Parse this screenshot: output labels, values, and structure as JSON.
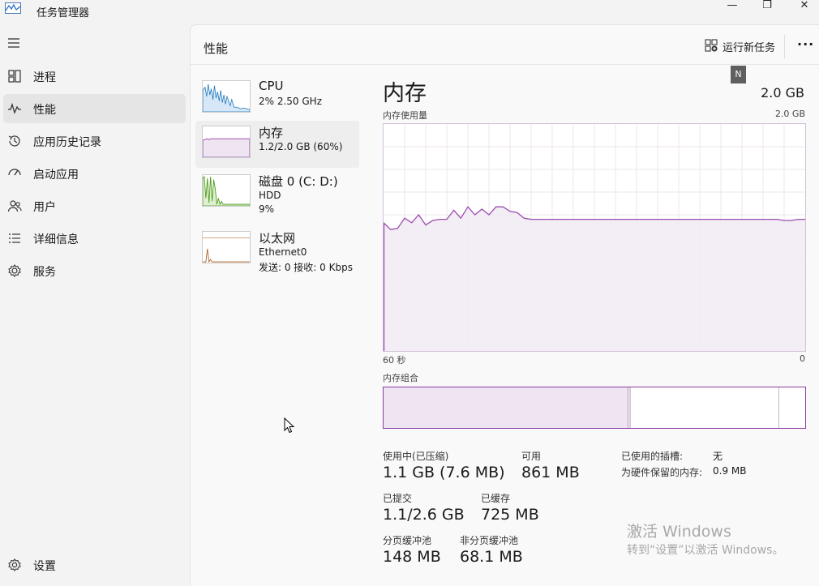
{
  "window": {
    "title": "任务管理器",
    "minimize": "—",
    "maximize": "❐",
    "close": "✕"
  },
  "sidebar": {
    "items": [
      {
        "label": "进程",
        "icon": "processes-icon"
      },
      {
        "label": "性能",
        "icon": "performance-icon",
        "active": true
      },
      {
        "label": "应用历史记录",
        "icon": "app-history-icon"
      },
      {
        "label": "启动应用",
        "icon": "startup-icon"
      },
      {
        "label": "用户",
        "icon": "users-icon"
      },
      {
        "label": "详细信息",
        "icon": "details-icon"
      },
      {
        "label": "服务",
        "icon": "services-icon"
      }
    ],
    "settings": "设置"
  },
  "header": {
    "title": "性能",
    "run_task": "运行新任务",
    "more": "···"
  },
  "resources": [
    {
      "name": "CPU",
      "line1": "2%  2.50 GHz",
      "line2": ""
    },
    {
      "name": "内存",
      "line1": "1.2/2.0 GB (60%)",
      "line2": ""
    },
    {
      "name": "磁盘 0 (C: D:)",
      "line1": "HDD",
      "line2": "9%"
    },
    {
      "name": "以太网",
      "line1": "Ethernet0",
      "line2": "发送: 0  接收: 0 Kbps"
    }
  ],
  "memory": {
    "title": "内存",
    "total": "2.0 GB",
    "badge": "N",
    "usage_label": "内存使用量",
    "usage_max": "2.0 GB",
    "x_left": "60 秒",
    "x_right": "0",
    "composition_label": "内存组合",
    "composition": {
      "in_use": 0.58,
      "modified": 0.005,
      "standby": 0.35
    },
    "stats": {
      "in_use_label": "使用中(已压缩)",
      "in_use_value": "1.1 GB (7.6 MB)",
      "available_label": "可用",
      "available_value": "861 MB",
      "committed_label": "已提交",
      "committed_value": "1.1/2.6 GB",
      "cached_label": "已缓存",
      "cached_value": "725 MB",
      "paged_label": "分页缓冲池",
      "paged_value": "148 MB",
      "nonpaged_label": "非分页缓冲池",
      "nonpaged_value": "68.1 MB",
      "slots_label": "已使用的插槽:",
      "slots_value": "无",
      "reserved_label": "为硬件保留的内存:",
      "reserved_value": "0.9 MB"
    }
  },
  "watermark": {
    "line1": "激活 Windows",
    "line2": "转到“设置”以激活 Windows。"
  },
  "chart_data": {
    "type": "area",
    "title": "",
    "xlabel": "",
    "ylabel": "",
    "xlim": [
      60,
      0
    ],
    "ylim": [
      0,
      2.0
    ],
    "series": [
      {
        "values": [
          1.13,
          1.07,
          1.08,
          1.17,
          1.13,
          1.2,
          1.11,
          1.15,
          1.16,
          1.16,
          1.24,
          1.17,
          1.27,
          1.2,
          1.25,
          1.2,
          1.27,
          1.27,
          1.23,
          1.22,
          1.17,
          1.16,
          1.16,
          1.16,
          1.16,
          1.16,
          1.16,
          1.16,
          1.16,
          1.16,
          1.16,
          1.16,
          1.16,
          1.16,
          1.16,
          1.16,
          1.16,
          1.16,
          1.16,
          1.16,
          1.16,
          1.16,
          1.16,
          1.16,
          1.16,
          1.16,
          1.16,
          1.16,
          1.16,
          1.16,
          1.16,
          1.16,
          1.16,
          1.16,
          1.16,
          1.16,
          1.16,
          1.15,
          1.15,
          1.16,
          1.16
        ]
      }
    ]
  }
}
